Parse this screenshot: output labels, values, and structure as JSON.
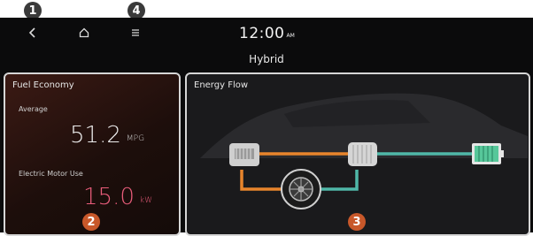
{
  "callouts": [
    "1",
    "2",
    "3",
    "4"
  ],
  "nav": {
    "back_icon": "back-chevron-icon",
    "home_icon": "home-icon",
    "menu_icon": "menu-icon"
  },
  "status": {
    "time": "12:00",
    "ampm": "AM",
    "mode": "Hybrid"
  },
  "fuel_economy": {
    "title": "Fuel Economy",
    "average_label": "Average",
    "average_value": "51.2",
    "average_unit": "MPG",
    "motor_label": "Electric Motor Use",
    "motor_value": "15.0",
    "motor_unit": "kW"
  },
  "energy_flow": {
    "title": "Energy Flow",
    "engine_icon": "engine-icon",
    "motor_icon": "motor-icon",
    "battery_icon": "battery-icon",
    "wheel_icon": "wheel-icon"
  },
  "colors": {
    "accent": "#c8582a",
    "flow_orange": "#e8852c",
    "flow_teal": "#4fb8a8",
    "motor_value": "#e85c7a",
    "battery": "#57c79a"
  }
}
